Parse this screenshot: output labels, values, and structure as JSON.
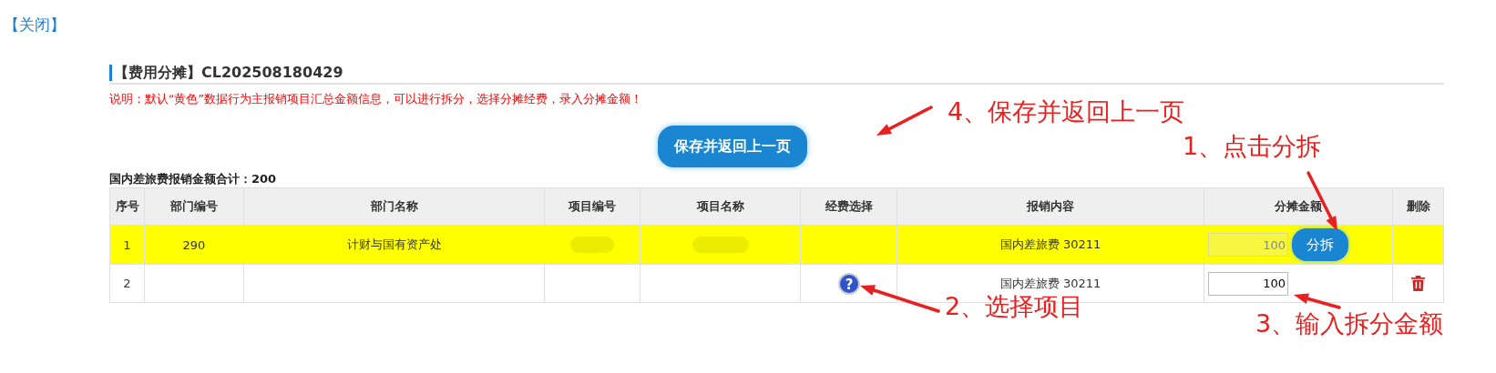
{
  "close_link": "【关闭】",
  "section": {
    "title": "【费用分摊】CL202508180429",
    "note": "说明：默认“黄色”数据行为主报销项目汇总金额信息，可以进行拆分，选择分摊经费，录入分摊金额！"
  },
  "save_button": "保存并返回上一页",
  "total_label": "国内差旅费报销金额合计：200",
  "table": {
    "columns": [
      "序号",
      "部门编号",
      "部门名称",
      "项目编号",
      "项目名称",
      "经费选择",
      "报销内容",
      "分摊金额",
      "删除"
    ],
    "rows": [
      {
        "kind": "main",
        "highlighted": true,
        "redacted": true,
        "seq": "1",
        "dept_code": "290",
        "dept_name": "计财与国有资产处",
        "content": "国内差旅费 30211",
        "amount": "100",
        "amount_readonly": true,
        "split_button": "分拆"
      },
      {
        "kind": "split",
        "highlighted": false,
        "redacted": false,
        "seq": "2",
        "help_icon": "?",
        "content": "国内差旅费 30211",
        "amount": "100",
        "amount_readonly": false
      }
    ]
  },
  "annotations": [
    {
      "text": "4、保存并返回上一页"
    },
    {
      "text": "1、点击分拆"
    },
    {
      "text": "2、选择项目"
    },
    {
      "text": "3、输入拆分金额"
    }
  ]
}
